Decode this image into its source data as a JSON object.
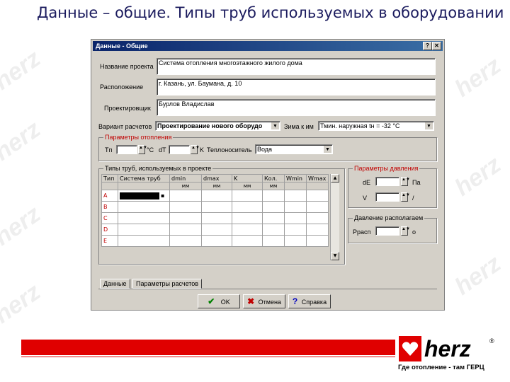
{
  "slide": {
    "title": "Данные – общие. Типы труб используемых в оборудовании",
    "tagline": "Где отопление - там ГЕРЦ",
    "brand": "herz",
    "brand_colors": {
      "red": "#e00000",
      "dark": "#1b1b5e"
    }
  },
  "dialog": {
    "title": "Данные - Общие",
    "fields": {
      "project_name": {
        "label": "Название проекта",
        "value": "Система отопления многоэтажного жилого дома"
      },
      "location": {
        "label": "Расположение",
        "value": "г. Казань, ул. Баумана, д. 10"
      },
      "designer": {
        "label": "Проектировщик",
        "value": "Бурлов Владислав"
      },
      "calc_variant": {
        "label": "Вариант расчетов",
        "value": "Проектирование нового оборудо"
      },
      "season": {
        "label": "Зима к им",
        "value": "Тмин. наружная tн = -32 °C"
      }
    },
    "heating_params": {
      "title": "Параметры отопления",
      "tp_label": "Tп",
      "tp_unit": "°C",
      "dt_label": "dT",
      "dt_unit": "K",
      "carrier_label": "Теплоноситель",
      "carrier_value": "Вода"
    },
    "pipe_types": {
      "title": "Типы труб, используемых в проекте",
      "headers": [
        "Тип",
        "Система труб",
        "dmin",
        "dmax",
        "K",
        "Кол.",
        "Wmin",
        "Wmax"
      ],
      "units": [
        "",
        "",
        "мм",
        "мм",
        "мм",
        "мм",
        "",
        ""
      ],
      "rows": [
        "A",
        "B",
        "C",
        "D",
        "E"
      ]
    },
    "pressure_params": {
      "title": "Параметры давления",
      "dp_label": "dE",
      "dp_unit": "Па",
      "v_label": "V",
      "v_unit": "/"
    },
    "available_pressure": {
      "title": "Давление располагаем",
      "p_label": "Pрасп",
      "p_unit": "о"
    },
    "tabs": [
      "Данные",
      "Параметры расчетов"
    ],
    "buttons": {
      "ok": "OK",
      "cancel": "Отмена",
      "help": "Справка"
    }
  }
}
